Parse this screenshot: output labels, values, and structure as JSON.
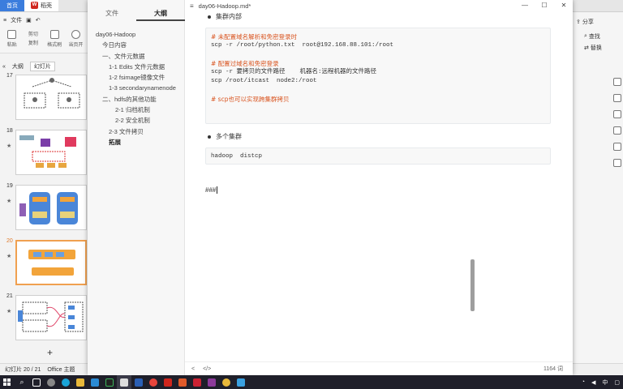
{
  "wps": {
    "tabs": {
      "home": "首页",
      "doc": "稻壳"
    },
    "menu": {
      "file": "文件"
    },
    "toolbar": {
      "paste": "粘贴",
      "cut": "剪切",
      "copy": "复制",
      "format_painter": "格式刷",
      "from_current": "当页开"
    },
    "slide_tabs": {
      "outline": "大纲",
      "slides": "幻灯片"
    },
    "slides": [
      {
        "num": "17",
        "star": ""
      },
      {
        "num": "18",
        "star": "★"
      },
      {
        "num": "19",
        "star": "★"
      },
      {
        "num": "20",
        "star": "★"
      },
      {
        "num": "21",
        "star": "★"
      }
    ],
    "add": "+",
    "status": {
      "slide_count": "幻灯片 20 / 21",
      "theme": "Office 主题"
    },
    "right": {
      "share": "分享",
      "find": "查找",
      "replace": "替换"
    }
  },
  "typora": {
    "sidebar_tabs": {
      "files": "文件",
      "outline": "大纲"
    },
    "outline": [
      {
        "text": "day06-Hadoop",
        "level": 1
      },
      {
        "text": "今日内容",
        "level": 2
      },
      {
        "text": "一、文件元数据",
        "level": 2
      },
      {
        "text": "1-1 Edits 文件元数据",
        "level": 3
      },
      {
        "text": "1-2 fsimage镜像文件",
        "level": 3
      },
      {
        "text": "1-3 secondarynamenode",
        "level": 3
      },
      {
        "text": "二、hdfs的其他功能",
        "level": 2
      },
      {
        "text": "2-1 归档机制",
        "level": 4
      },
      {
        "text": "2-2 安全机制",
        "level": 4
      },
      {
        "text": "2-3 文件拷贝",
        "level": 3
      },
      {
        "text": "拓展",
        "level": 3
      }
    ],
    "title": "day06-Hadoop.md*",
    "menu_icon": "≡",
    "window": {
      "minimize": "—",
      "maximize": "☐",
      "close": "✕"
    },
    "editor": {
      "bullet1": "集群内部",
      "code1": [
        {
          "text": "# 未配置域名解析和免密登录时",
          "comment": true
        },
        {
          "text": "scp -r /root/python.txt  root@192.168.88.101:/root",
          "comment": false
        },
        {
          "text": "",
          "comment": false
        },
        {
          "text": "# 配置过域名和免密登录",
          "comment": true
        },
        {
          "text": "scp -r 要拷贝的文件路径    机器名:远程机器的文件路径",
          "comment": false
        },
        {
          "text": "scp /root/itcast  node2:/root",
          "comment": false
        },
        {
          "text": "",
          "comment": false
        },
        {
          "text": "# scp也可以实现跨集群拷贝",
          "comment": true
        }
      ],
      "bullet2": "多个集群",
      "code2": "hadoop  distcp",
      "heading_text": "###"
    },
    "status": {
      "back": "<",
      "source": "</>",
      "word_count": "1164 词"
    }
  },
  "taskbar": {
    "search_icon": "search-icon",
    "time": "",
    "apps": [
      "windows-icon",
      "search-icon",
      "task-view-icon",
      "edge-icon",
      "explorer-icon",
      "vscode-icon",
      "pycharm-icon",
      "typora-icon",
      "chrome-icon",
      "wps-icon"
    ]
  }
}
